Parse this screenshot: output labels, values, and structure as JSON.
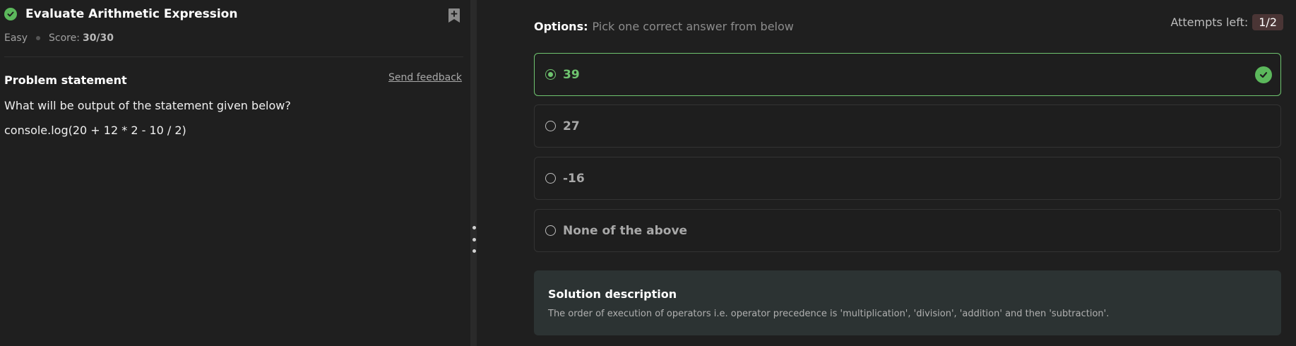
{
  "problem": {
    "title": "Evaluate Arithmetic Expression",
    "difficulty": "Easy",
    "score_label": "Score:",
    "score_value": "30/30",
    "status_icon": "check-circle-icon",
    "bookmark_icon": "bookmark-plus-icon"
  },
  "statement": {
    "heading": "Problem statement",
    "feedback_link": "Send feedback",
    "question": "What will be output of the statement given below?",
    "code": "console.log(20 + 12 * 2 - 10 / 2)"
  },
  "options_panel": {
    "label_bold": "Options:",
    "label_hint": "Pick one correct answer from below",
    "attempts_label": "Attempts left:",
    "attempts_value": "1/2",
    "options": [
      {
        "text": "39",
        "selected": true,
        "correct": true
      },
      {
        "text": "27",
        "selected": false,
        "correct": false
      },
      {
        "text": "-16",
        "selected": false,
        "correct": false
      },
      {
        "text": "None of the above",
        "selected": false,
        "correct": false
      }
    ]
  },
  "solution": {
    "title": "Solution description",
    "text": "The order of execution of operators i.e. operator precedence is 'multiplication', 'division', 'addition' and then 'subtraction'."
  },
  "colors": {
    "accent_green": "#6fc46f",
    "background": "#1f1f1f",
    "solution_bg": "#2c3333",
    "attempts_badge_bg": "#4a3535"
  }
}
